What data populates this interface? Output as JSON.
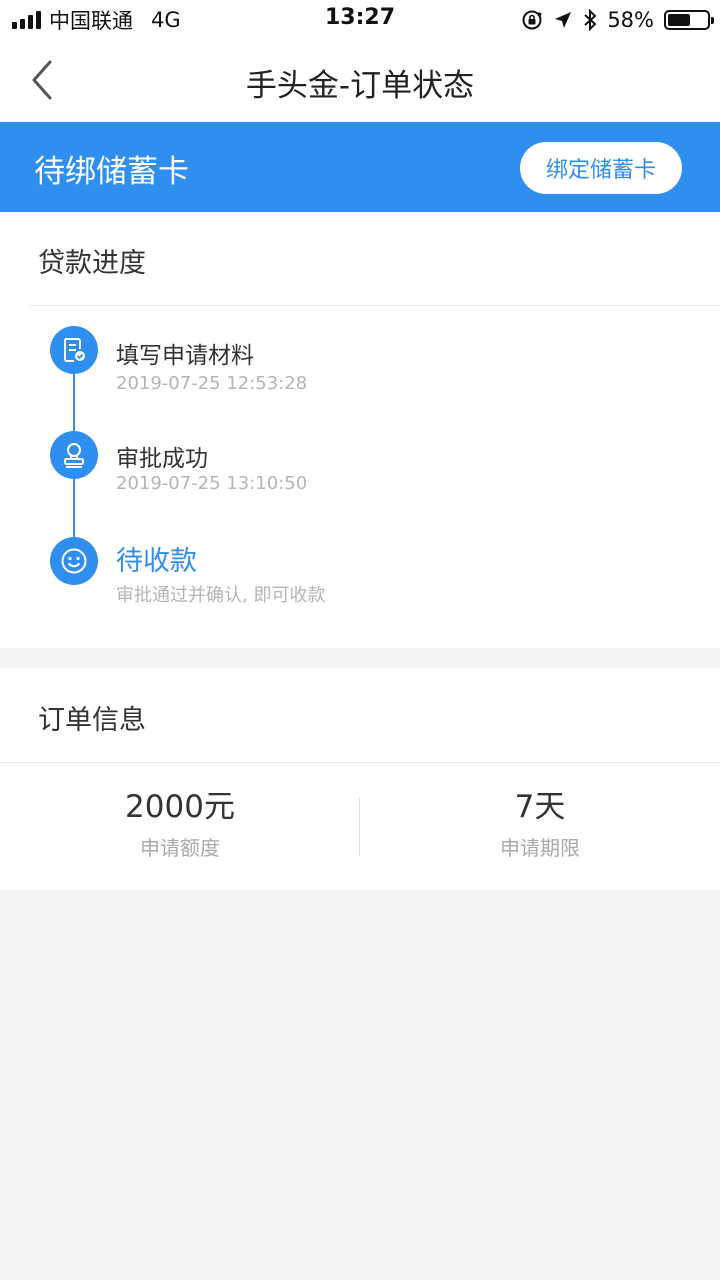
{
  "status_bar": {
    "carrier": "中国联通",
    "network": "4G",
    "time": "13:27",
    "battery_text": "58%",
    "battery_level": 0.58,
    "icons": [
      "signal-icon",
      "orientation-lock-icon",
      "location-arrow-icon",
      "bluetooth-icon",
      "battery-icon"
    ]
  },
  "nav": {
    "title": "手头金-订单状态",
    "back_icon": "chevron-left-icon"
  },
  "banner": {
    "status_title": "待绑储蓄卡",
    "bind_button_label": "绑定储蓄卡",
    "color": "#2f8ff0"
  },
  "progress": {
    "section_title": "贷款进度",
    "steps": [
      {
        "title": "填写申请材料",
        "subtitle": "2019-07-25 12:53:28",
        "icon": "document-check-icon",
        "active": false
      },
      {
        "title": "审批成功",
        "subtitle": "2019-07-25 13:10:50",
        "icon": "approval-stamp-icon",
        "active": false
      },
      {
        "title": "待收款",
        "subtitle": "审批通过并确认, 即可收款",
        "icon": "smiley-icon",
        "active": true
      }
    ]
  },
  "order": {
    "section_title": "订单信息",
    "stats": [
      {
        "value": "2000元",
        "label": "申请额度"
      },
      {
        "value": "7天",
        "label": "申请期限"
      }
    ]
  },
  "colors": {
    "accent": "#2f8ff0",
    "background": "#f4f4f4",
    "muted_text": "#b4b4b4"
  }
}
